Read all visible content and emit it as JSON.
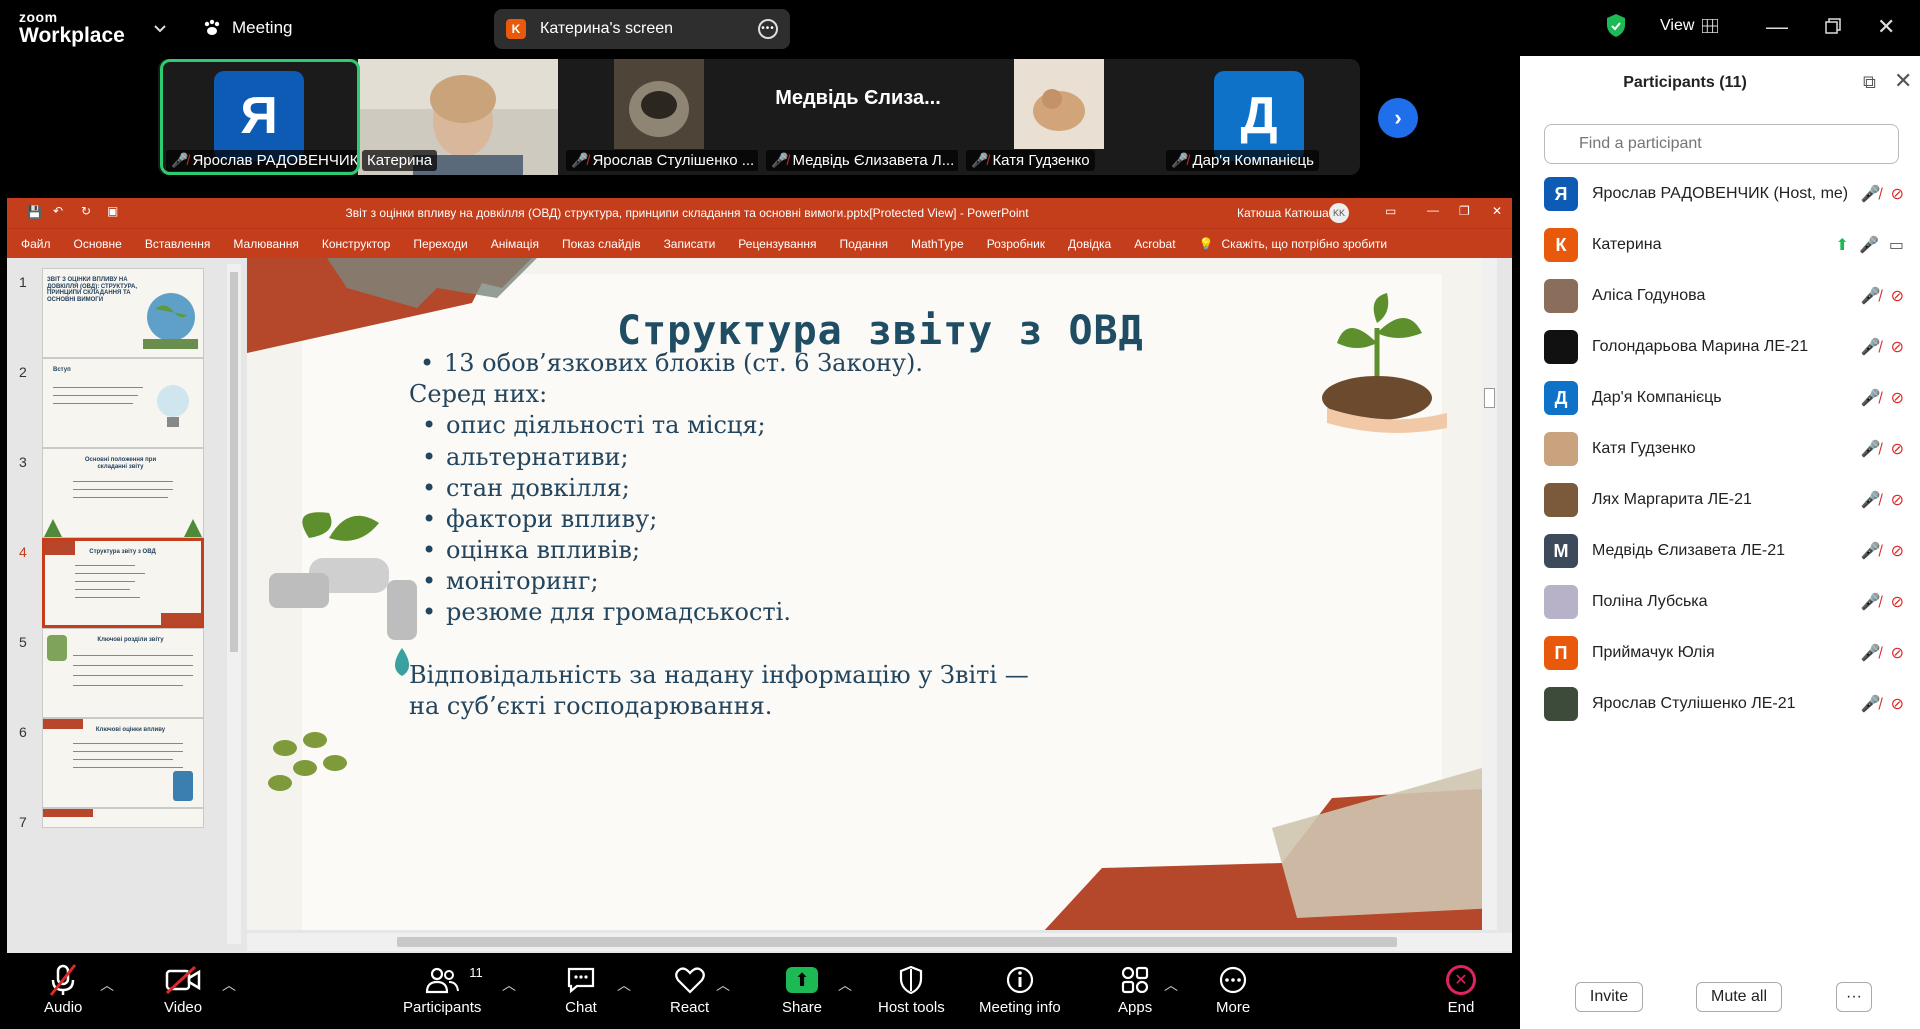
{
  "app": {
    "logo_top": "zoom",
    "logo_bottom": "Workplace",
    "meeting_label": "Meeting"
  },
  "share_pill": {
    "badge": "K",
    "title": "Катерина's screen"
  },
  "view_label": "View",
  "strip": {
    "tiles": [
      {
        "name": "Ярослав РАДОВЕНЧИК",
        "avatar": "Я",
        "avatar_color": "#0e5bb5"
      },
      {
        "name": "Катерина"
      },
      {
        "name": "Ярослав Стулішенко ..."
      },
      {
        "name": "Медвідь Єлизавета Л...",
        "big_name": "Медвідь Єлиза..."
      },
      {
        "name": "Катя Гудзенко"
      },
      {
        "name": "Дар'я Компанієць",
        "avatar": "Д",
        "avatar_color": "#0e72c9"
      }
    ]
  },
  "ppt": {
    "window_title": "Звіт з оцінки впливу на довкілля (ОВД) структура, принципи складання та основні вимоги.pptx[Protected View] - PowerPoint",
    "user_name": "Катюша Катюша",
    "user_initials": "KK",
    "ribbon": [
      "Файл",
      "Основне",
      "Вставлення",
      "Малювання",
      "Конструктор",
      "Переходи",
      "Анімація",
      "Показ слайдів",
      "Записати",
      "Рецензування",
      "Подання",
      "MathType",
      "Розробник",
      "Довідка",
      "Acrobat"
    ],
    "tell_me": "Скажіть, що потрібно зробити",
    "thumbs": [
      {
        "num": "1",
        "title": "ЗВІТ З ОЦІНКИ ВПЛИВУ НА ДОВКІЛЛЯ (ОВД): СТРУКТУРА, ПРИНЦИПИ СКЛАДАННЯ ТА ОСНОВНІ ВИМОГИ"
      },
      {
        "num": "2",
        "title": "Вступ"
      },
      {
        "num": "3",
        "title": "Основні положення при складанні звіту"
      },
      {
        "num": "4",
        "title": "Структура звіту з ОВД"
      },
      {
        "num": "5",
        "title": "Ключові розділи звіту"
      },
      {
        "num": "6",
        "title": "Ключові оцінки впливу"
      },
      {
        "num": "7",
        "title": ""
      }
    ],
    "slide": {
      "title": "Структура звіту з ОВД",
      "line1": "13 обов’язкових блоків (ст. 6 Закону).",
      "among": "Серед них:",
      "bullets": [
        "опис діяльності та місця;",
        "альтернативи;",
        "стан довкілля;",
        "фактори впливу;",
        "оцінка впливів;",
        "моніторинг;",
        "резюме для громадськості."
      ],
      "footer1": "Відповідальність за надану інформацію у Звіті —",
      "footer2": "на суб’єкті господарювання."
    }
  },
  "toolbar": {
    "audio": "Audio",
    "video": "Video",
    "participants": "Participants",
    "participants_count": "11",
    "chat": "Chat",
    "react": "React",
    "share": "Share",
    "host_tools": "Host tools",
    "meeting_info": "Meeting info",
    "apps": "Apps",
    "more": "More",
    "end": "End"
  },
  "panel": {
    "title": "Participants (11)",
    "search_placeholder": "Find a participant",
    "participants": [
      {
        "name": "Ярослав РАДОВЕНЧИК (Host, me)",
        "avatar": "Я",
        "color": "#0e5bb5"
      },
      {
        "name": "Катерина",
        "avatar": "К",
        "color": "#e8590c"
      },
      {
        "name": "Аліса Годунова",
        "avatar": "",
        "color": "#8a6d5b"
      },
      {
        "name": "Голондарьова Марина ЛЕ-21",
        "avatar": "",
        "color": "#111111"
      },
      {
        "name": "Дар'я Компанієць",
        "avatar": "Д",
        "color": "#0e72c9"
      },
      {
        "name": "Катя Гудзенко",
        "avatar": "",
        "color": "#c9a27e"
      },
      {
        "name": "Лях Маргарита ЛЕ-21",
        "avatar": "",
        "color": "#7a5a3a"
      },
      {
        "name": "Медвідь Єлизавета ЛЕ-21",
        "avatar": "М",
        "color": "#3d4a5c"
      },
      {
        "name": "Поліна Лубська",
        "avatar": "",
        "color": "#b8b2c8"
      },
      {
        "name": "Приймачук Юлія",
        "avatar": "П",
        "color": "#e8590c"
      },
      {
        "name": "Ярослав Стулішенко ЛЕ-21",
        "avatar": "",
        "color": "#3c4b3a"
      }
    ],
    "invite": "Invite",
    "mute_all": "Mute all",
    "more": "···"
  }
}
